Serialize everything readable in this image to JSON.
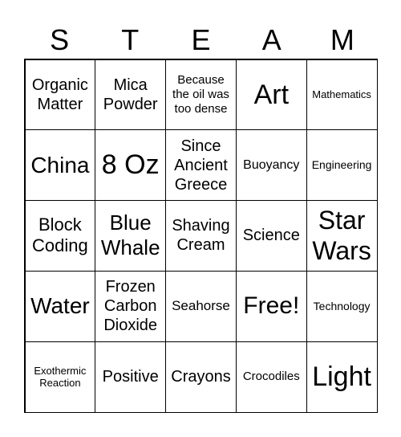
{
  "header": {
    "letters": [
      "S",
      "T",
      "E",
      "A",
      "M"
    ]
  },
  "cells": [
    "Organic Matter",
    "Mica Powder",
    "Because the oil was too dense",
    "Art",
    "Mathematics",
    "China",
    "8 Oz",
    "Since Ancient Greece",
    "Buoyancy",
    "Engineering",
    "Block Coding",
    "Blue Whale",
    "Shaving Cream",
    "Science",
    "Star Wars",
    "Water",
    "Frozen Carbon Dioxide",
    "Seahorse",
    "Free!",
    "Technology",
    "Exothermic Reaction",
    "Positive",
    "Crayons",
    "Crocodiles",
    "Light"
  ]
}
